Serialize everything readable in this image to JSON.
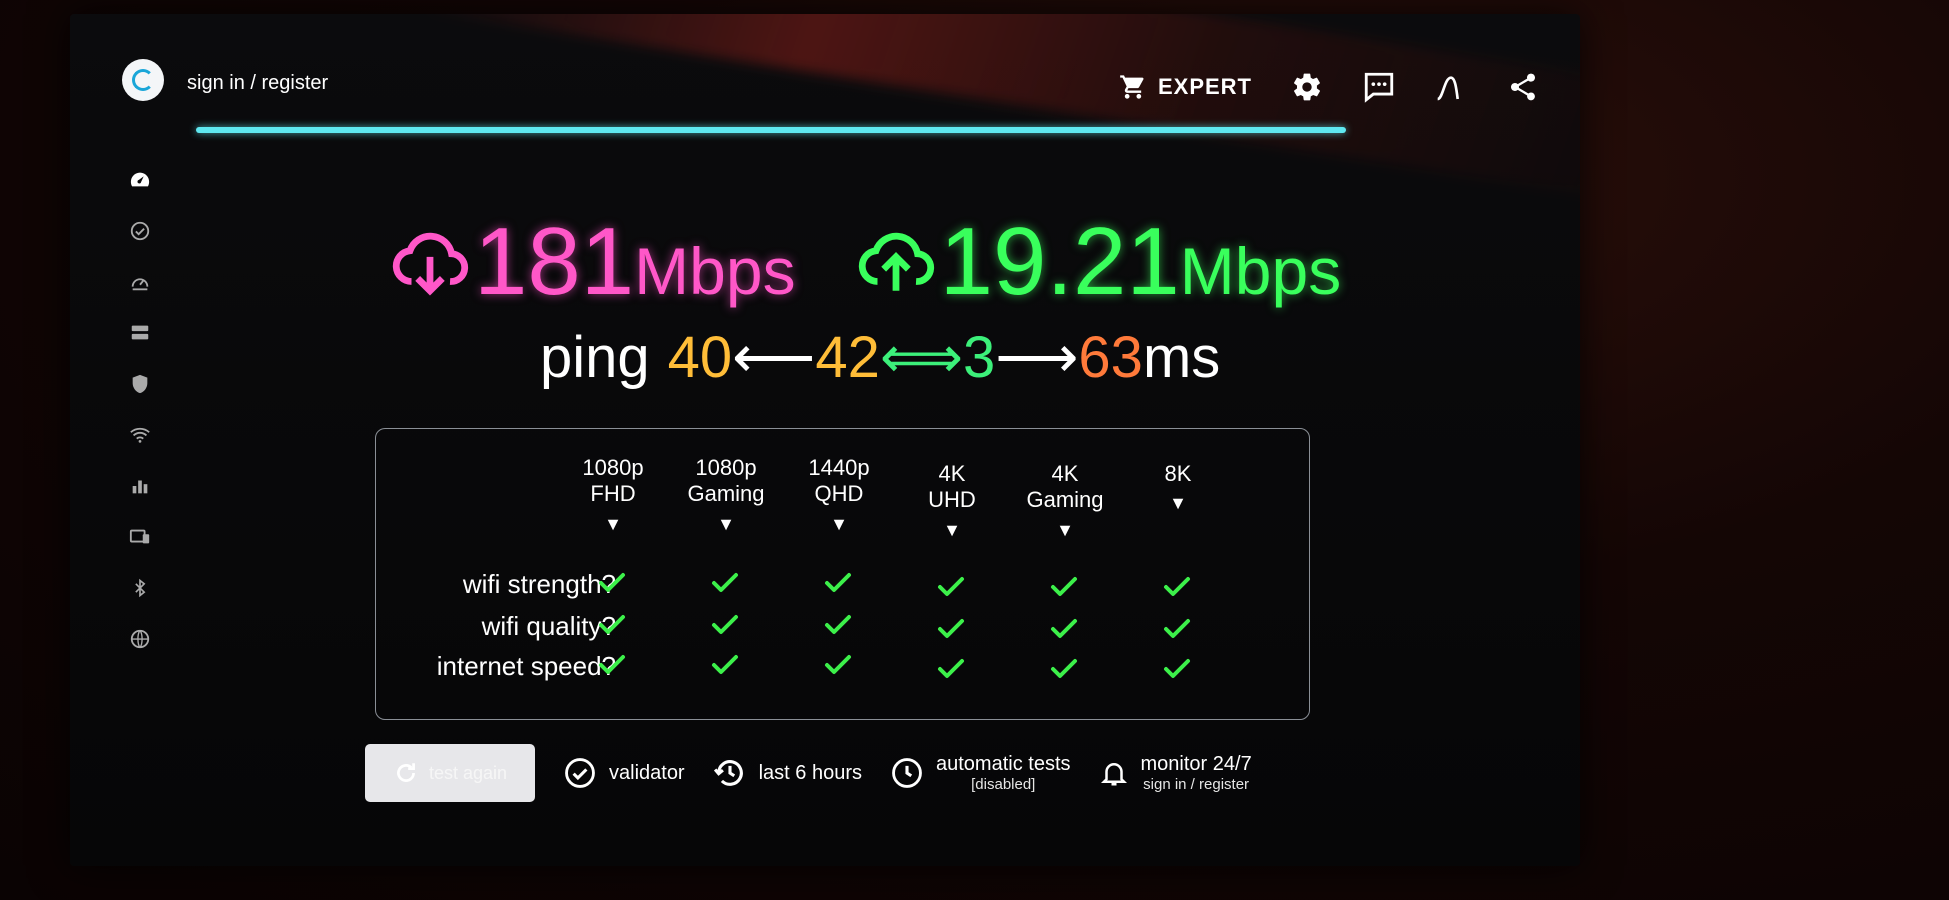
{
  "header": {
    "signin_label": "sign in / register",
    "expert_label": "EXPERT",
    "icons": [
      "cart-icon",
      "gear-icon",
      "chat-icon",
      "graph-icon",
      "share-icon"
    ]
  },
  "test_progress": 1.0,
  "sidebar": {
    "icons": [
      "speedometer-icon",
      "check-circle-icon",
      "speed-history-icon",
      "server-icon",
      "shield-icon",
      "wifi-icon",
      "bar-chart-icon",
      "devices-icon",
      "bluetooth-icon",
      "globe-icon"
    ]
  },
  "results": {
    "download_value": "181",
    "download_unit": "Mbps",
    "upload_value": "19.21",
    "upload_unit": "Mbps",
    "ping_label": "ping",
    "ping_a": "40",
    "ping_b": "42",
    "ping_c": "3",
    "ping_d": "63",
    "ping_unit": "ms",
    "arrow_left": "⟵",
    "arrow_both": "⟺",
    "arrow_right": "⟶"
  },
  "matrix": {
    "columns": [
      {
        "line1": "1080p",
        "line2": "FHD"
      },
      {
        "line1": "1080p",
        "line2": "Gaming"
      },
      {
        "line1": "1440p",
        "line2": "QHD"
      },
      {
        "line1": "4K",
        "line2": "UHD"
      },
      {
        "line1": "4K",
        "line2": "Gaming"
      },
      {
        "line1": "",
        "line2": "8K"
      }
    ],
    "column_arrow": "▼",
    "rows": [
      "wifi strength?",
      "wifi quality?",
      "internet speed?"
    ],
    "status": "pass",
    "status_color": "#3cf04a"
  },
  "actions": {
    "test_again": "test again",
    "validator": "validator",
    "last_hours": "last 6 hours",
    "automatic_tests": "automatic tests",
    "automatic_tests_sub": "[disabled]",
    "monitor": "monitor 24/7",
    "monitor_sub": "sign in / register"
  },
  "colors": {
    "download": "#ff57c8",
    "upload": "#39ff5c",
    "progress": "#5fe8f0"
  }
}
